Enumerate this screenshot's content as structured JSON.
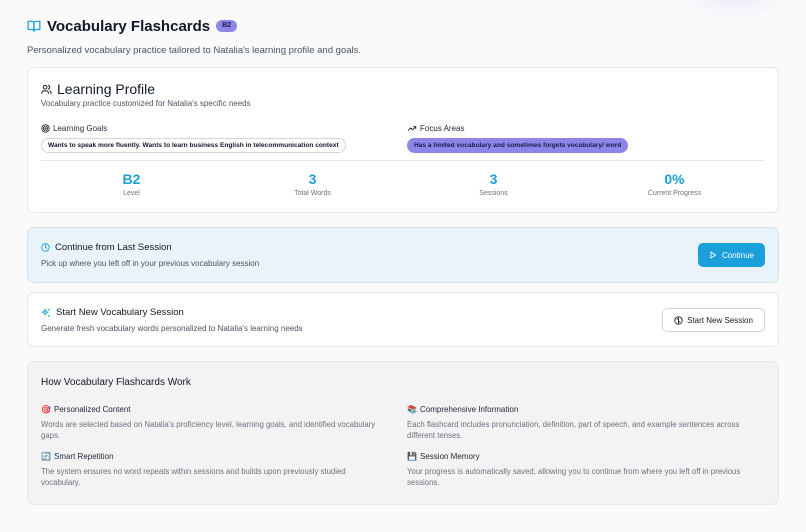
{
  "header": {
    "title": "Vocabulary Flashcards",
    "level_badge": "B2",
    "subtitle": "Personalized vocabulary practice tailored to Natalia's learning profile and goals."
  },
  "profile": {
    "title": "Learning Profile",
    "description": "Vocabulary practice customized for Natalia's specific needs",
    "goals": {
      "label": "Learning Goals",
      "value": "Wants to speak more fluently. Wants to learn business English in telecommunication context"
    },
    "focus": {
      "label": "Focus Areas",
      "value": "Has a limited vocabulary and sometimes forgets vocabulary/ word"
    },
    "stats": [
      {
        "value": "B2",
        "label": "Level"
      },
      {
        "value": "3",
        "label": "Total Words"
      },
      {
        "value": "3",
        "label": "Sessions"
      },
      {
        "value": "0%",
        "label": "Current Progress"
      }
    ]
  },
  "continue_card": {
    "title": "Continue from Last Session",
    "description": "Pick up where you left off in your previous vocabulary session",
    "button": "Continue"
  },
  "new_card": {
    "title": "Start New Vocabulary Session",
    "description": "Generate fresh vocabulary words personalized to Natalia's learning needs",
    "button": "Start New Session"
  },
  "how": {
    "title": "How Vocabulary Flashcards Work",
    "features": [
      {
        "icon": "🎯",
        "title": "Personalized Content",
        "description": "Words are selected based on Natalia's proficiency level, learning goals, and identified vocabulary gaps."
      },
      {
        "icon": "📚",
        "title": "Comprehensive Information",
        "description": "Each flashcard includes pronunciation, definition, part of speech, and example sentences across different tenses."
      },
      {
        "icon": "🔄",
        "title": "Smart Repetition",
        "description": "The system ensures no word repeats within sessions and builds upon previously studied vocabulary."
      },
      {
        "icon": "💾",
        "title": "Session Memory",
        "description": "Your progress is automatically saved, allowing you to continue from where you left off in previous sessions."
      }
    ]
  },
  "colors": {
    "accent": "#1ba0dc",
    "badge": "#8b86e8",
    "continue_bg": "#eaf3f9"
  }
}
